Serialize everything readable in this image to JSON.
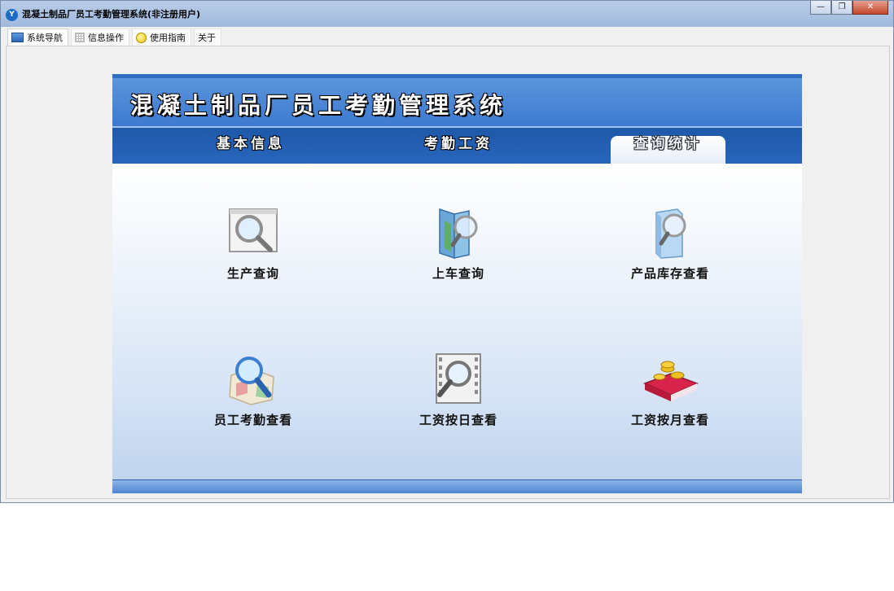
{
  "window": {
    "title": "混凝土制品厂员工考勤管理系统(非注册用户)"
  },
  "menu": {
    "items": [
      {
        "label": "系统导航",
        "icon": "monitor-icon"
      },
      {
        "label": "信息操作",
        "icon": "grid-icon"
      },
      {
        "label": "使用指南",
        "icon": "help-icon"
      },
      {
        "label": "关于",
        "icon": ""
      }
    ]
  },
  "header": {
    "title": "混凝土制品厂员工考勤管理系统"
  },
  "tabs": [
    {
      "label": "基本信息"
    },
    {
      "label": "考勤工资"
    },
    {
      "label": "查询统计",
      "active": true
    }
  ],
  "tiles": [
    {
      "label": "生产查询",
      "icon": "magnifier-window-icon"
    },
    {
      "label": "上车查询",
      "icon": "folder-magnifier-icon"
    },
    {
      "label": "产品库存查看",
      "icon": "box-magnifier-icon"
    },
    {
      "label": "员工考勤查看",
      "icon": "map-magnifier-icon"
    },
    {
      "label": "工资按日查看",
      "icon": "film-magnifier-icon"
    },
    {
      "label": "工资按月查看",
      "icon": "book-coins-icon"
    }
  ],
  "colors": {
    "header_blue": "#3d7ad0",
    "tab_blue": "#2766bd",
    "body_gradient_end": "#c0d4ee"
  }
}
